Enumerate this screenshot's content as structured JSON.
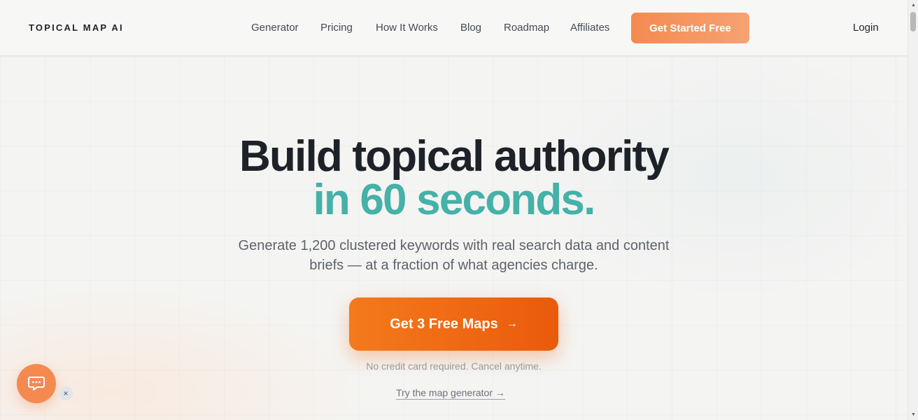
{
  "header": {
    "logo": "TOPICAL MAP AI",
    "nav": [
      "Generator",
      "Pricing",
      "How It Works",
      "Blog",
      "Roadmap",
      "Affiliates"
    ],
    "cta_label": "Get Started Free",
    "login_label": "Login"
  },
  "hero": {
    "headline_line1": "Build topical authority",
    "headline_line2": "in 60 seconds.",
    "subtitle_line1": "Generate 1,200 clustered keywords with real search data and content",
    "subtitle_line2": "briefs — at a fraction of what agencies charge.",
    "cta_label": "Get 3 Free Maps",
    "cta_arrow": "→",
    "note": "No credit card required. Cancel anytime.",
    "secondary_link": "Try the map generator →"
  },
  "chat_widget": {
    "icon": "chat-bubble-icon",
    "close_glyph": "×"
  },
  "scrollbar": {
    "up_glyph": "▲",
    "down_glyph": "▼"
  },
  "colors": {
    "accent_teal": "#45b1a8",
    "cta_orange": "#f47a1c",
    "header_cta_orange": "#f58a50",
    "text_dark": "#1d2128"
  }
}
